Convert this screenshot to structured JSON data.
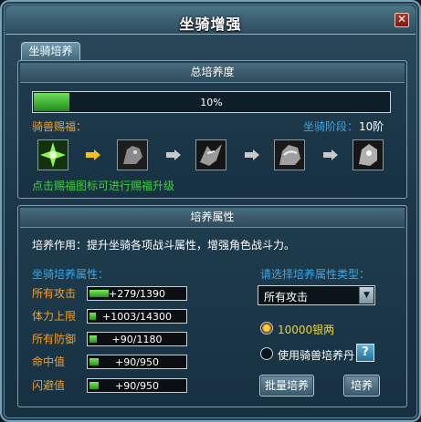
{
  "window": {
    "title": "坐骑增强",
    "close_icon": "close-icon"
  },
  "tab": {
    "label": "坐骑培养"
  },
  "cultivation": {
    "header": "总培养度",
    "progress_percent": 10,
    "progress_text": "10%",
    "bless_label": "骑兽赐福：",
    "stage_label": "坐骑阶段：",
    "stage_value": "10阶",
    "icons": [
      "green-burst-icon",
      "gray-beast-icon-1",
      "gray-beast-icon-2",
      "gray-beast-icon-3",
      "gray-beast-icon-4"
    ],
    "hint": "点击赐福图标可进行赐福升级"
  },
  "attributes": {
    "header": "培养属性",
    "description": "培养作用：提升坐骑各项战斗属性，增强角色战斗力。",
    "left_title": "坐骑培养属性：",
    "right_title": "请选择培养属性类型：",
    "rows": [
      {
        "label": "所有攻击",
        "value": "+279/1390",
        "fill": 0.2
      },
      {
        "label": "体力上限",
        "value": "+1003/14300",
        "fill": 0.07
      },
      {
        "label": "所有防御",
        "value": "+90/1180",
        "fill": 0.08
      },
      {
        "label": "命中值",
        "value": "+90/950",
        "fill": 0.1
      },
      {
        "label": "闪避值",
        "value": "+90/950",
        "fill": 0.1
      }
    ],
    "select_value": "所有攻击",
    "option_silver": "10000银两",
    "option_pill": "使用骑兽培养丹",
    "help_label": "?",
    "batch_button": "批量培养",
    "train_button": "培养"
  },
  "colors": {
    "accent_orange": "#f0a02a",
    "accent_blue": "#3aa8e8",
    "accent_green": "#3ed33a"
  }
}
